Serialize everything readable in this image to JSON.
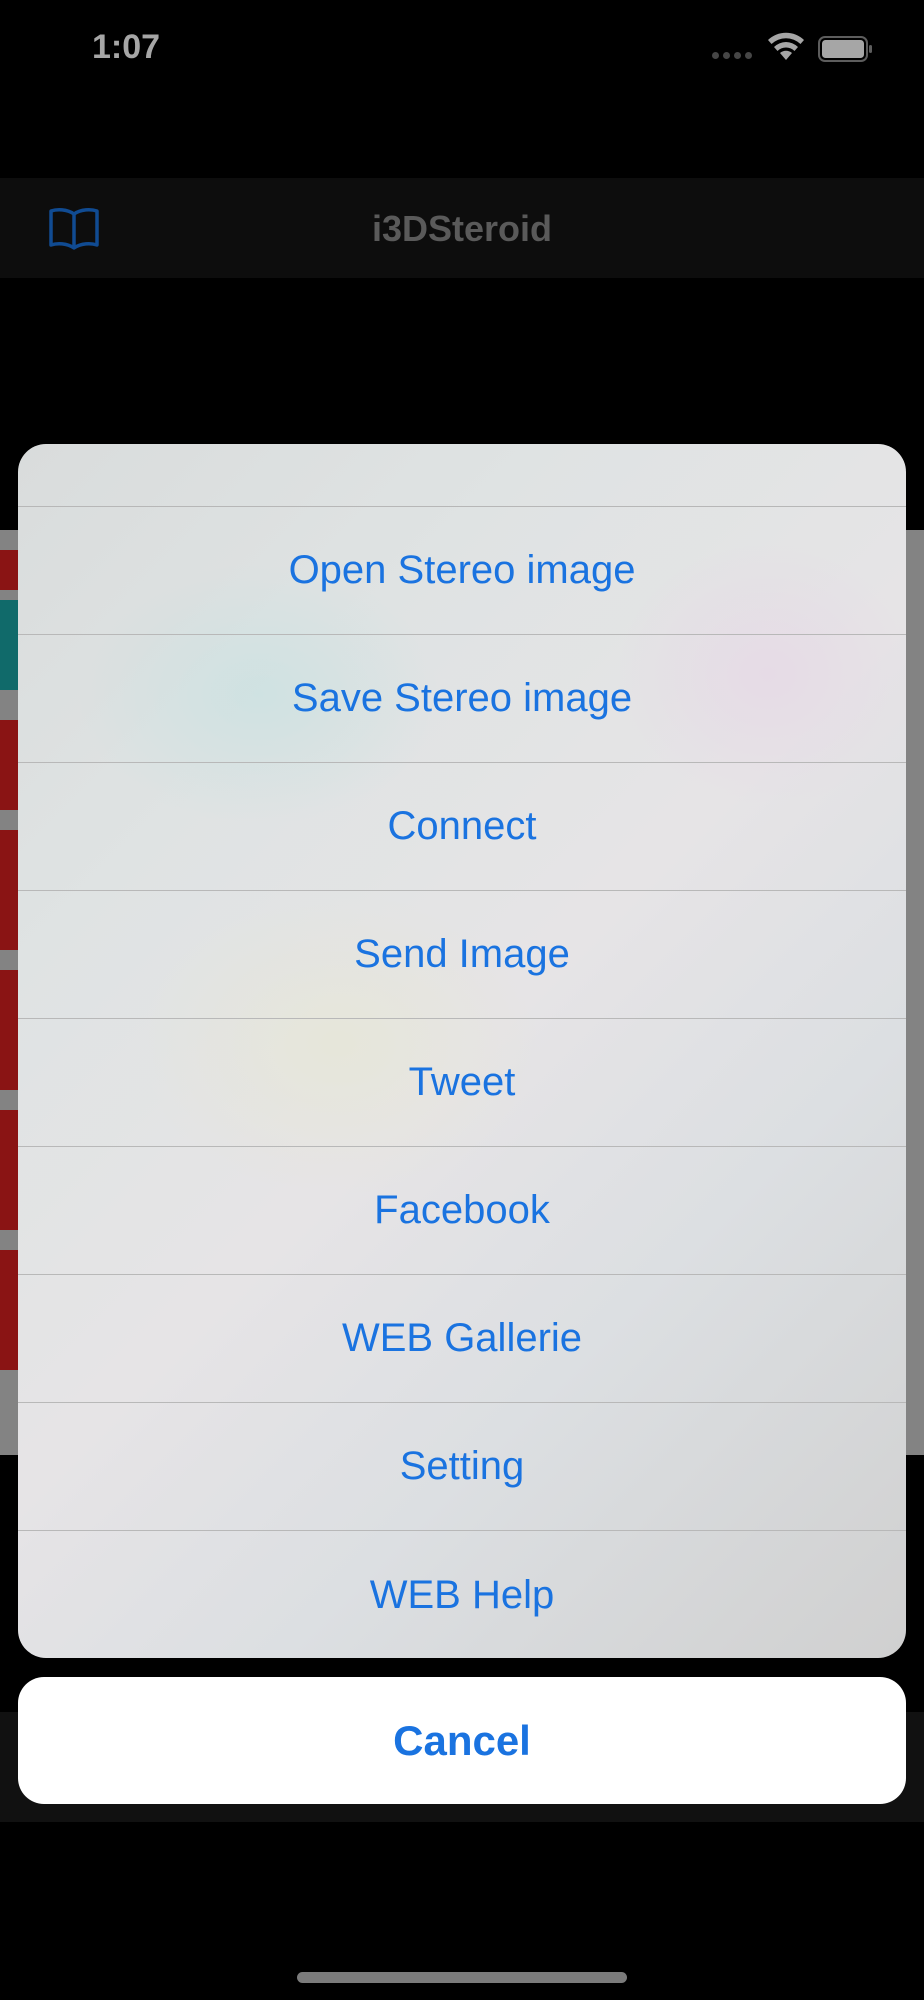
{
  "status_bar": {
    "time": "1:07"
  },
  "nav": {
    "title": "i3DSteroid"
  },
  "action_sheet": {
    "items": [
      {
        "label": "Open Stereo image"
      },
      {
        "label": "Save Stereo image"
      },
      {
        "label": "Connect"
      },
      {
        "label": "Send Image"
      },
      {
        "label": "Tweet"
      },
      {
        "label": "Facebook"
      },
      {
        "label": "WEB Gallerie"
      },
      {
        "label": "Setting"
      },
      {
        "label": "WEB Help"
      }
    ],
    "cancel_label": "Cancel"
  },
  "colors": {
    "accent": "#1a73e0",
    "sheet_bg": "#dcdfe0",
    "background": "#000000"
  },
  "icons": {
    "nav_left": "book-icon",
    "wifi": "wifi-icon",
    "battery": "battery-icon",
    "signal": "signal-icon"
  }
}
